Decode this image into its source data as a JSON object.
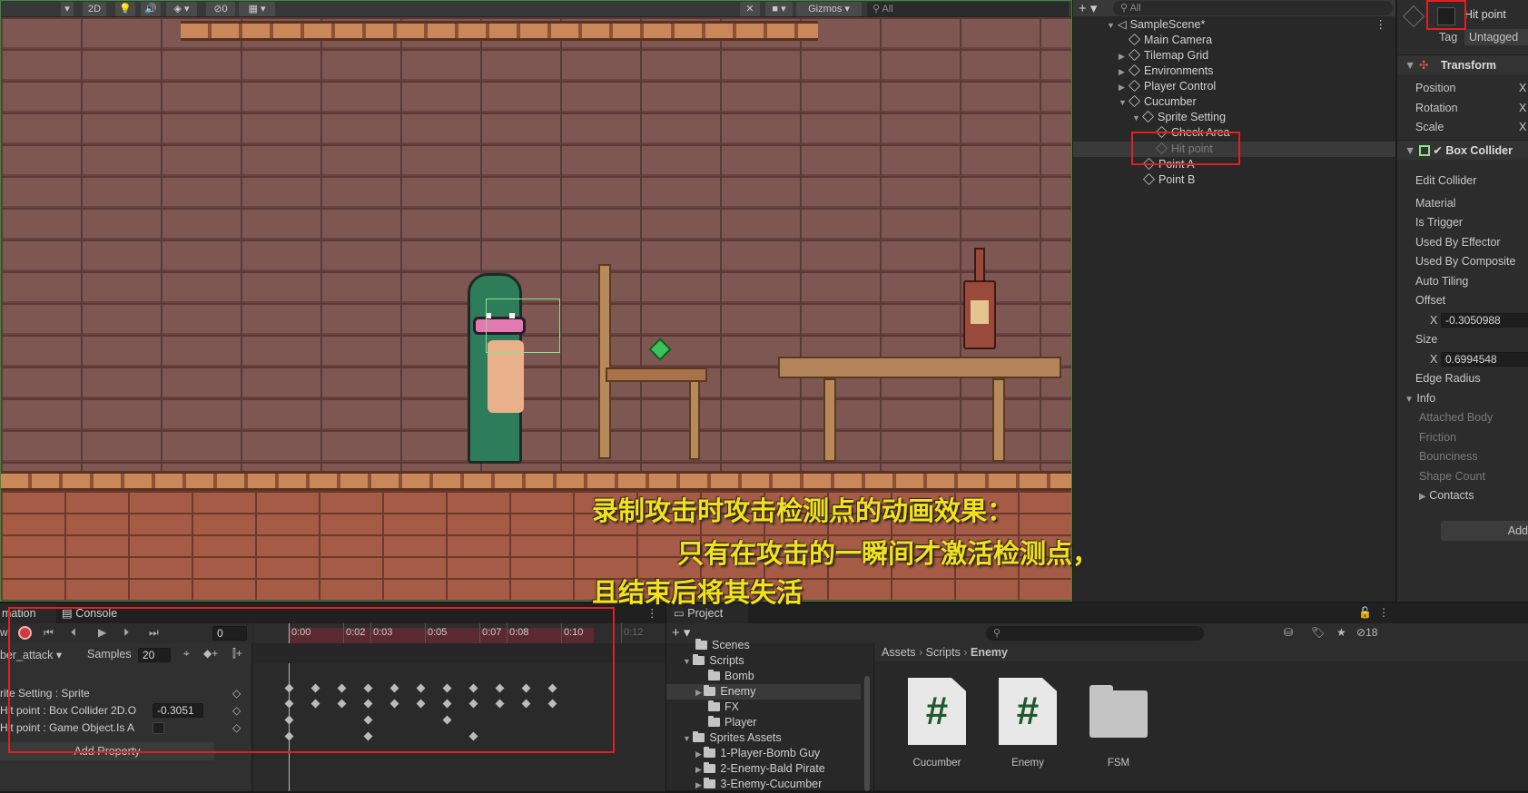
{
  "scene_toolbar": {
    "mode_2d": "2D",
    "hidden_count": "0",
    "gizmos": "Gizmos",
    "search_placeholder": "All"
  },
  "hierarchy": {
    "search_placeholder": "All",
    "scene_name": "SampleScene*",
    "items": [
      {
        "label": "Main Camera"
      },
      {
        "label": "Tilemap Grid"
      },
      {
        "label": "Environments"
      },
      {
        "label": "Player Control"
      },
      {
        "label": "Cucumber"
      },
      {
        "label": "Sprite Setting"
      },
      {
        "label": "Check Area"
      },
      {
        "label": "Hit point"
      },
      {
        "label": "Point A"
      },
      {
        "label": "Point B"
      }
    ]
  },
  "inspector": {
    "object_name": "Hit point",
    "tag_label": "Tag",
    "tag_value": "Untagged",
    "transform": {
      "title": "Transform",
      "rows": [
        "Position",
        "Rotation",
        "Scale"
      ],
      "axis": "X"
    },
    "box_collider": {
      "title": "Box Collider",
      "rows": [
        "Edit Collider",
        "Material",
        "Is Trigger",
        "Used By Effector",
        "Used By Composite",
        "Auto Tiling",
        "Offset"
      ],
      "offset_axis": "X",
      "offset_x": "-0.3050988",
      "size_label": "Size",
      "size_axis": "X",
      "size_x": "0.6994548",
      "edge_radius": "Edge Radius",
      "info": "Info",
      "info_rows": [
        "Attached Body",
        "Friction",
        "Bounciness",
        "Shape Count"
      ],
      "contacts": "Contacts"
    },
    "add_button": "Add"
  },
  "animation": {
    "tab_animation": "mation",
    "tab_console": "Console",
    "frame_value": "0",
    "clip_name": "ber_attack",
    "samples_label": "Samples",
    "samples_value": "20",
    "timeline_labels": [
      "0:00",
      "0:02",
      "0:03",
      "0:05",
      "0:07",
      "0:08",
      "0:10",
      "0:12"
    ],
    "properties": [
      {
        "label": "rite Setting : Sprite"
      },
      {
        "label": "Hit point : Box Collider 2D.O",
        "value": "-0.3051"
      },
      {
        "label": "Hit point : Game Object.Is A"
      }
    ],
    "add_property": "Add Property",
    "record_partial": "w"
  },
  "project": {
    "tab": "Project",
    "hidden_count": "18",
    "tree": [
      {
        "label": "Scenes"
      },
      {
        "label": "Scripts"
      },
      {
        "label": "Bomb"
      },
      {
        "label": "Enemy"
      },
      {
        "label": "FX"
      },
      {
        "label": "Player"
      },
      {
        "label": "Sprites Assets"
      },
      {
        "label": "1-Player-Bomb Guy"
      },
      {
        "label": "2-Enemy-Bald Pirate"
      },
      {
        "label": "3-Enemy-Cucumber"
      }
    ],
    "breadcrumb": [
      "Assets",
      "Scripts",
      "Enemy"
    ],
    "assets": [
      {
        "name": "Cucumber",
        "type": "script"
      },
      {
        "name": "Enemy",
        "type": "script"
      },
      {
        "name": "FSM",
        "type": "folder"
      }
    ]
  },
  "caption": {
    "line1": "录制攻击时攻击检测点的动画效果：",
    "line2": "只有在攻击的一瞬间才激活检测点，",
    "line3": "且结束后将其失活"
  }
}
